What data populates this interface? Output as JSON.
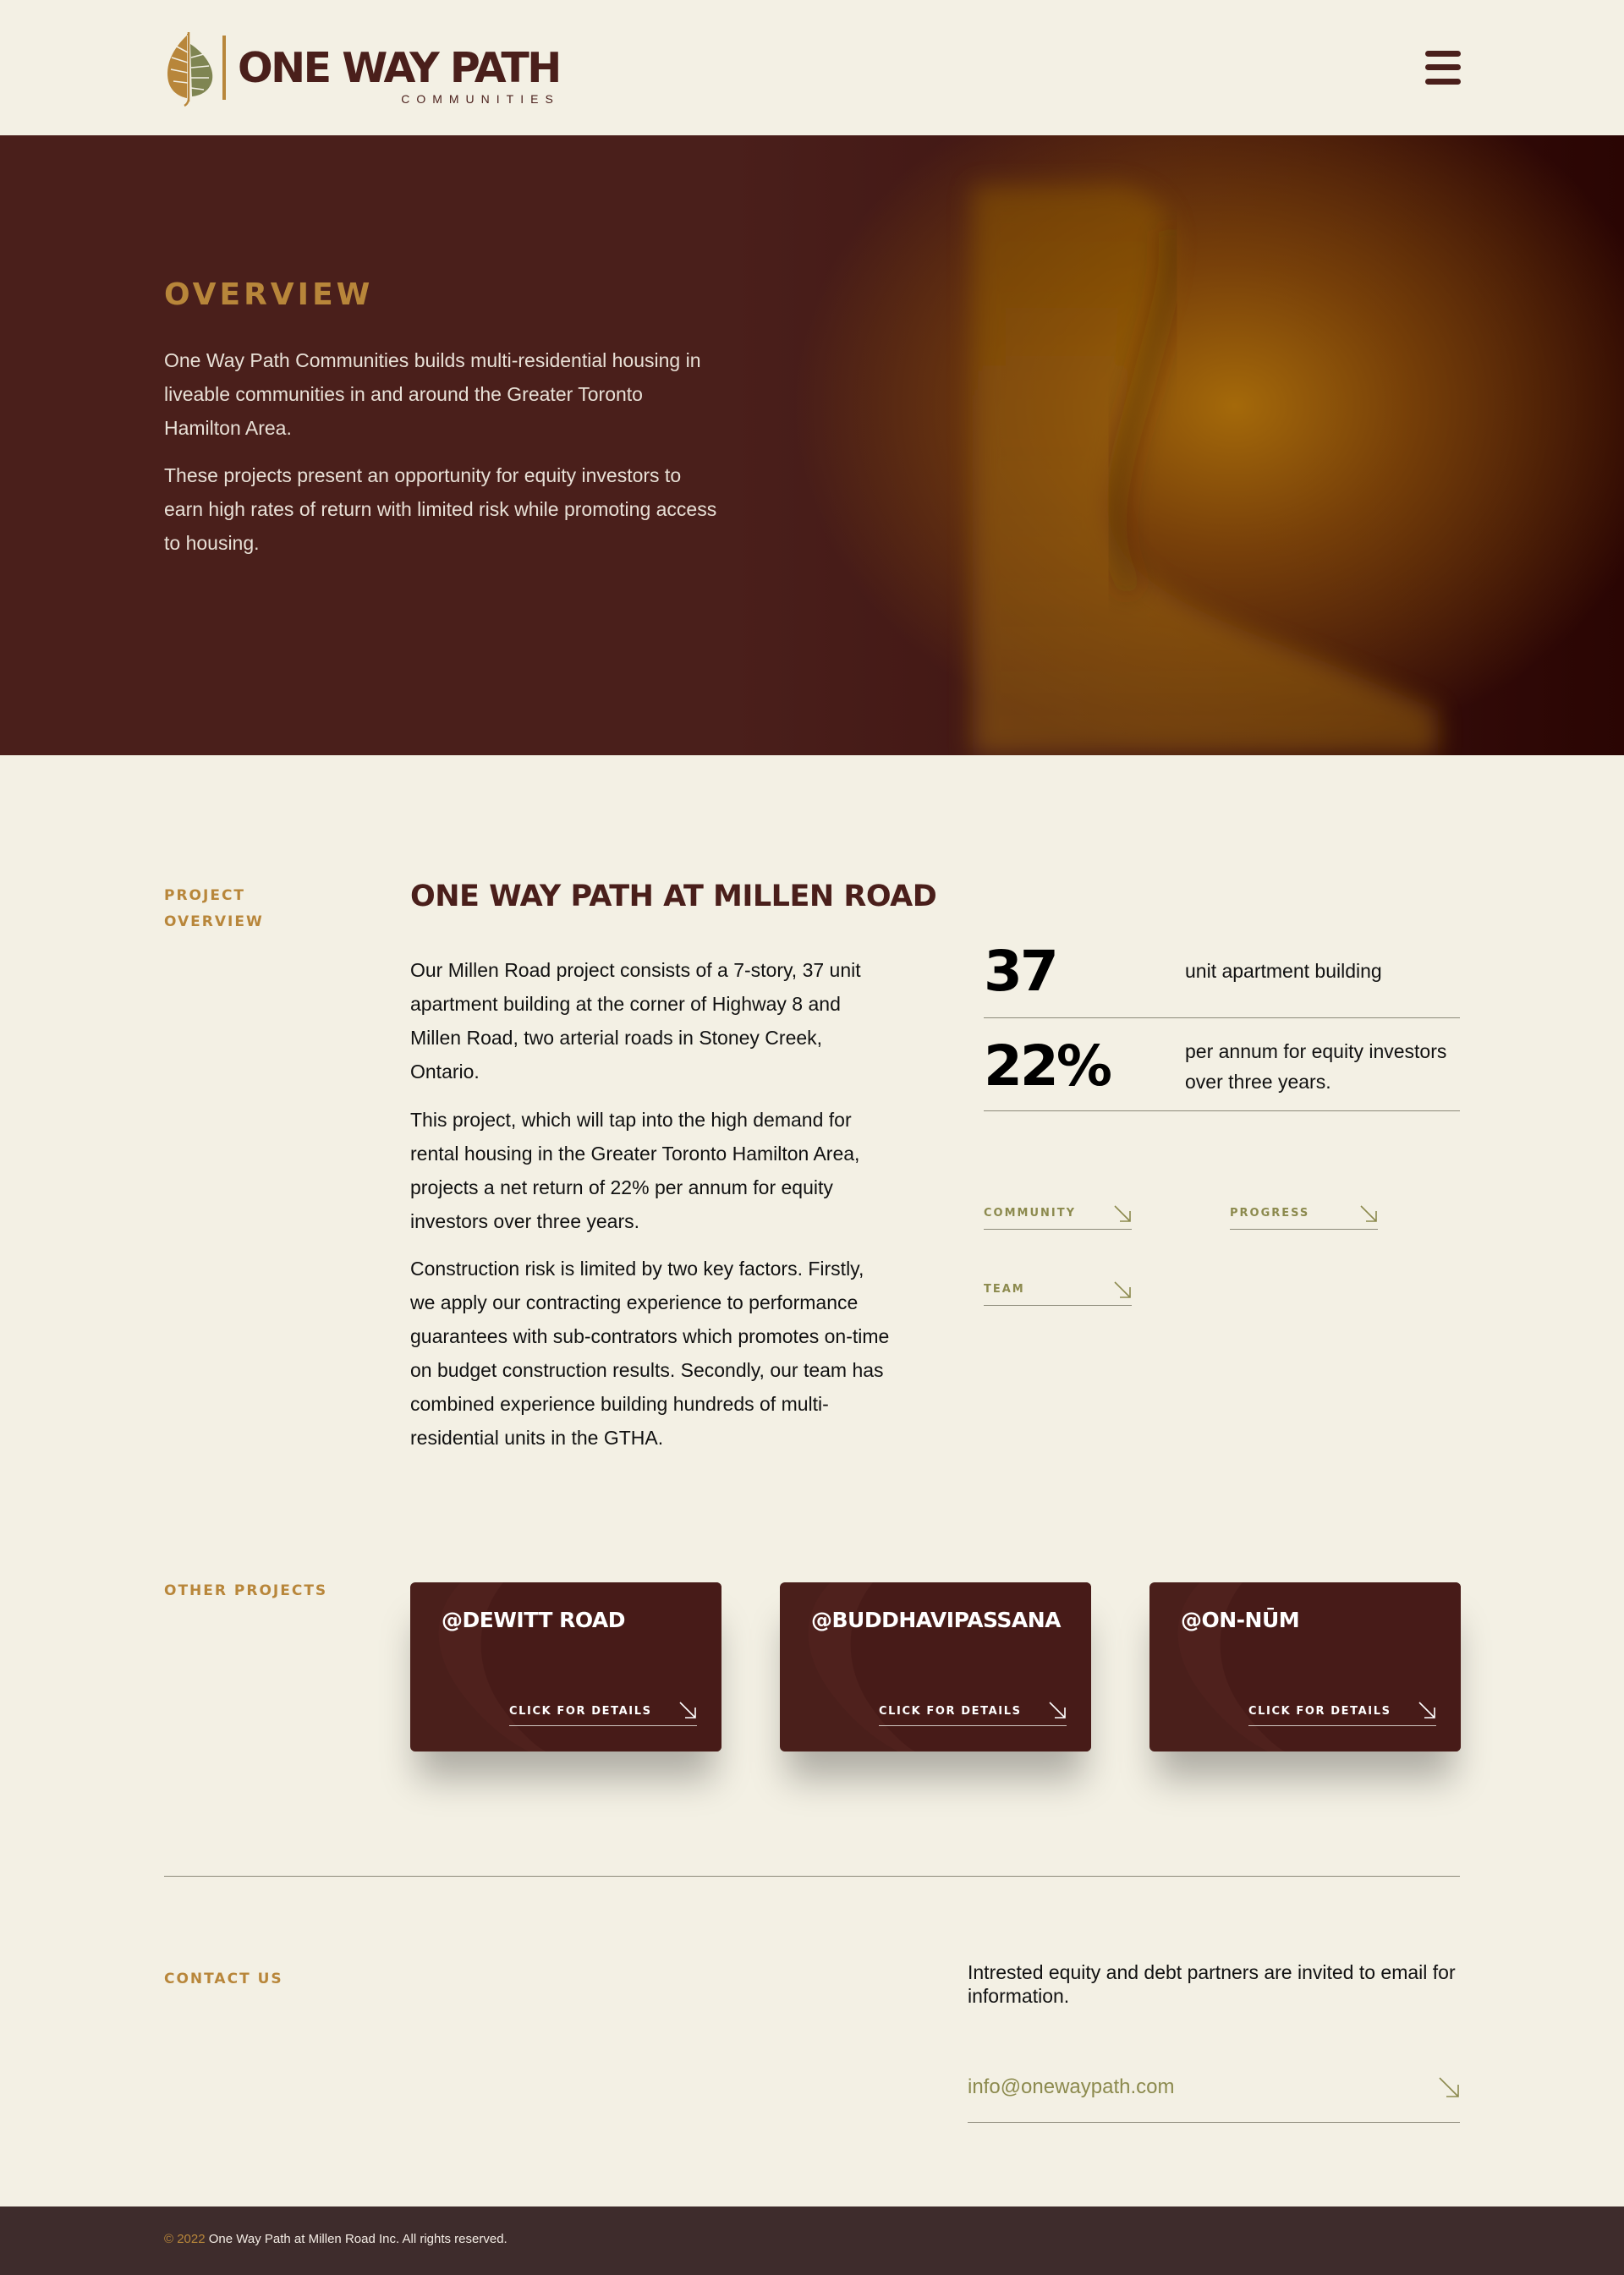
{
  "brand": {
    "name": "ONE WAY PATH",
    "subtitle": "COMMUNITIES"
  },
  "colors": {
    "primary": "#4a1f1b",
    "accent": "#b8863a",
    "olive": "#8c8a4e",
    "background": "#f3f0e4",
    "footer": "#3e2c2c"
  },
  "icons": {
    "menu": "hamburger-menu-icon",
    "arrow": "arrow-down-right-icon",
    "logo": "leaf-logo-icon"
  },
  "hero": {
    "overline": "OVERVIEW",
    "paragraphs": [
      "One Way Path Communities builds multi-residential housing in liveable communities in and around the Greater Toronto Hamilton Area.",
      "These projects present an opportunity for equity investors to earn high rates of return with limited risk while promoting access to housing."
    ]
  },
  "project": {
    "section_label": "PROJECT OVERVIEW",
    "title": "ONE WAY PATH AT MILLEN ROAD",
    "paragraphs": [
      "Our Millen Road project consists of a 7-story, 37 unit apartment building at the corner of Highway 8 and Millen Road, two arterial roads in Stoney Creek, Ontario.",
      "This project, which will tap into the high demand for rental housing in the Greater Toronto Hamilton Area, projects a net return of 22% per annum for equity investors over three years.",
      "Construction risk is limited by two key factors. Firstly, we apply our contracting experience to performance guarantees with sub-contrators which promotes on-time on budget construction results. Secondly, our team has combined experience building hundreds of multi-residential units in the GTHA."
    ],
    "stats": [
      {
        "value": "37",
        "description": "unit apartment building"
      },
      {
        "value": "22%",
        "description": "per annum for equity investors over three years."
      }
    ],
    "links": [
      "COMMUNITY",
      "PROGRESS",
      "TEAM"
    ]
  },
  "other_projects": {
    "section_label": "OTHER PROJECTS",
    "cards": [
      {
        "title": "@DEWITT ROAD",
        "link_label": "CLICK FOR DETAILS"
      },
      {
        "title": "@BUDDHAVIPASSANA",
        "link_label": "CLICK FOR DETAILS"
      },
      {
        "title": "@ON-NŪM",
        "link_label": "CLICK FOR DETAILS"
      }
    ]
  },
  "contact": {
    "section_label": "CONTACT US",
    "text": "Intrested equity and debt partners are invited to email for information.",
    "email": "info@onewaypath.com"
  },
  "footer": {
    "year": "© 2022",
    "text": "One Way Path at Millen Road Inc. All rights reserved."
  }
}
